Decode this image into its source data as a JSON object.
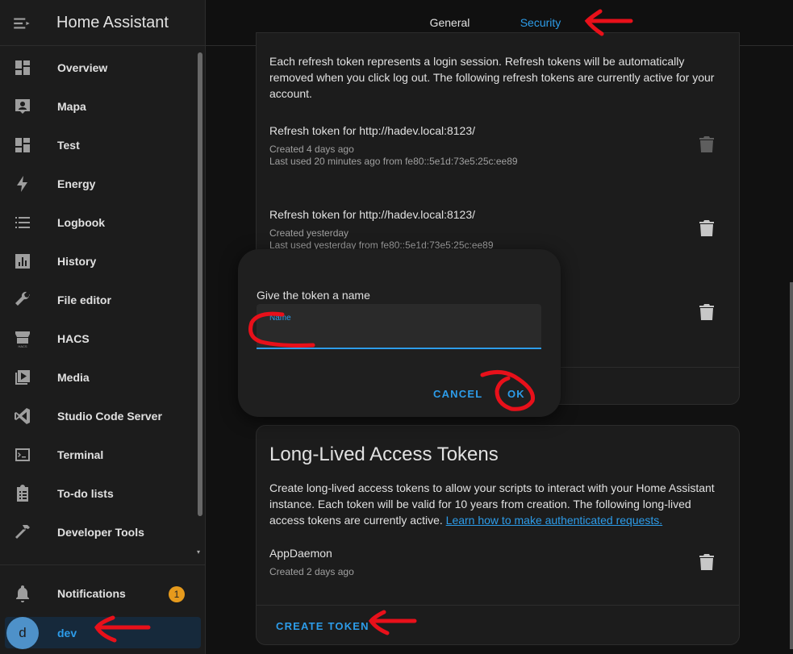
{
  "app": {
    "title": "Home Assistant"
  },
  "sidebar": {
    "items": [
      {
        "label": "Overview",
        "icon": "dashboard-icon"
      },
      {
        "label": "Mapa",
        "icon": "map-account-icon"
      },
      {
        "label": "Test",
        "icon": "dashboard-icon"
      },
      {
        "label": "Energy",
        "icon": "lightning-bolt-icon"
      },
      {
        "label": "Logbook",
        "icon": "list-icon"
      },
      {
        "label": "History",
        "icon": "chart-box-icon"
      },
      {
        "label": "File editor",
        "icon": "wrench-icon"
      },
      {
        "label": "HACS",
        "icon": "hacs-store-icon"
      },
      {
        "label": "Media",
        "icon": "play-box-icon"
      },
      {
        "label": "Studio Code Server",
        "icon": "vscode-icon"
      },
      {
        "label": "Terminal",
        "icon": "console-icon"
      },
      {
        "label": "To-do lists",
        "icon": "clipboard-list-icon"
      },
      {
        "label": "Developer Tools",
        "icon": "hammer-icon"
      }
    ],
    "notifications": {
      "label": "Notifications",
      "count": "1"
    },
    "user": {
      "initial": "d",
      "name": "dev"
    }
  },
  "tabs": {
    "general": "General",
    "security": "Security",
    "active": "Security"
  },
  "refresh_tokens": {
    "description": "Each refresh token represents a login session. Refresh tokens will be automatically removed when you click log out. The following refresh tokens are currently active for your account.",
    "items": [
      {
        "title": "Refresh token for http://hadev.local:8123/",
        "created": "Created 4 days ago",
        "last_used": "Last used 20 minutes ago from fe80::5e1d:73e5:25c:ee89"
      },
      {
        "title": "Refresh token for http://hadev.local:8123/",
        "created": "Created yesterday",
        "last_used": "Last used yesterday from fe80::5e1d:73e5:25c:ee89"
      }
    ]
  },
  "long_lived": {
    "title": "Long-Lived Access Tokens",
    "description": "Create long-lived access tokens to allow your scripts to interact with your Home Assistant instance. Each token will be valid for 10 years from creation. The following long-lived access tokens are currently active.",
    "link": "Learn how to make authenticated requests.",
    "tokens": [
      {
        "name": "AppDaemon",
        "created": "Created 2 days ago"
      }
    ],
    "create_button": "CREATE TOKEN"
  },
  "dialog": {
    "title": "Give the token a name",
    "field_label": "Name",
    "field_value": "",
    "cancel": "CANCEL",
    "ok": "OK"
  },
  "colors": {
    "accent": "#2d9ce9",
    "annotation": "#e8101a",
    "badge": "#e69a1c"
  }
}
